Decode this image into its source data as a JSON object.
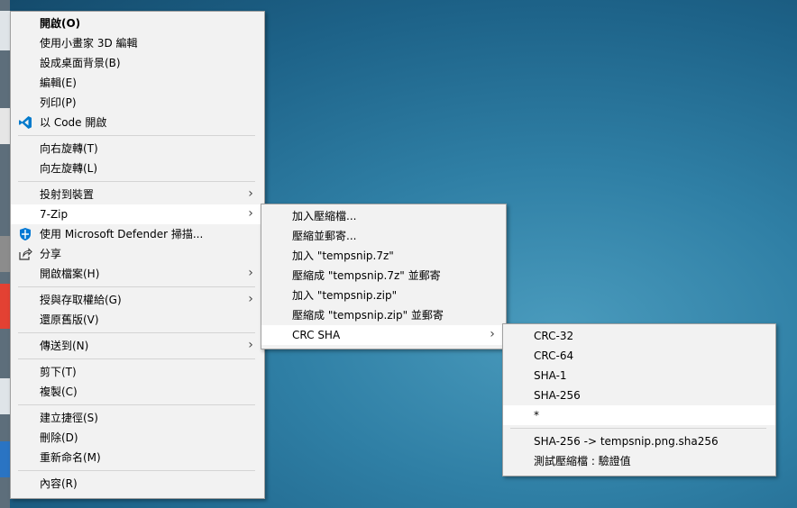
{
  "main_menu": {
    "items": [
      "開啟(O)",
      "使用小畫家 3D 編輯",
      "設成桌面背景(B)",
      "編輯(E)",
      "列印(P)",
      "以 Code 開啟",
      "向右旋轉(T)",
      "向左旋轉(L)",
      "投射到裝置",
      "7-Zip",
      "使用 Microsoft Defender 掃描...",
      "分享",
      "開啟檔案(H)",
      "授與存取權給(G)",
      "還原舊版(V)",
      "傳送到(N)",
      "剪下(T)",
      "複製(C)",
      "建立捷徑(S)",
      "刪除(D)",
      "重新命名(M)",
      "內容(R)"
    ]
  },
  "zip_menu": {
    "items": [
      "加入壓縮檔...",
      "壓縮並郵寄...",
      "加入 \"tempsnip.7z\"",
      "壓縮成 \"tempsnip.7z\" 並郵寄",
      "加入 \"tempsnip.zip\"",
      "壓縮成 \"tempsnip.zip\" 並郵寄",
      "CRC SHA"
    ]
  },
  "crc_menu": {
    "items": [
      "CRC-32",
      "CRC-64",
      "SHA-1",
      "SHA-256",
      "*",
      "SHA-256 -> tempsnip.png.sha256",
      "測試壓縮檔 : 驗證值"
    ]
  },
  "colors": {
    "menu_bg": "#f2f2f2",
    "highlight": "#ffffff",
    "vscode_blue": "#007acc",
    "defender_blue": "#0078d4"
  },
  "icons": {
    "vscode": "vscode-icon",
    "defender": "defender-icon",
    "share": "share-icon",
    "submenu": "chevron-right-icon"
  }
}
